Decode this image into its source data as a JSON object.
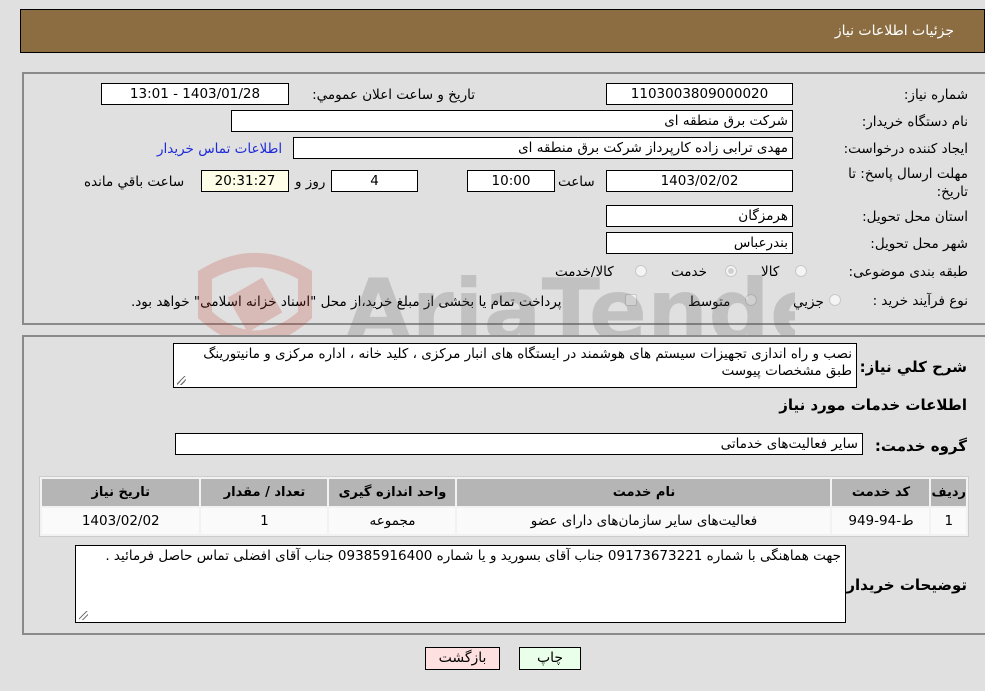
{
  "header": {
    "title": "جزئیات اطلاعات نیاز"
  },
  "form": {
    "need_number": {
      "label": "شماره نیاز:",
      "value": "1103003809000020"
    },
    "announce_datetime": {
      "label": "تاریخ و ساعت اعلان عمومي:",
      "value": "1403/01/28 - 13:01"
    },
    "buyer_org": {
      "label": "نام دستگاه خریدار:",
      "value": "شرکت برق منطقه ای"
    },
    "requester": {
      "label": "ایجاد کننده درخواست:",
      "value": "مهدی ترابی زاده کارپرداز شرکت برق منطقه ای"
    },
    "buyer_contact_link": "اطلاعات تماس خریدار",
    "deadline": {
      "label": "مهلت ارسال پاسخ: تا تاریخ:",
      "date": "1403/02/02",
      "time_label": "ساعت",
      "time": "10:00",
      "days": "4",
      "days_label": "روز و",
      "remaining": "20:31:27",
      "remaining_label": "ساعت باقي مانده"
    },
    "province": {
      "label": "استان محل تحویل:",
      "value": "هرمزگان"
    },
    "city": {
      "label": "شهر محل تحویل:",
      "value": "بندرعباس"
    },
    "category": {
      "label": "طبقه بندی موضوعی:",
      "options": [
        "کالا",
        "خدمت",
        "کالا/خدمت"
      ],
      "selected": "خدمت"
    },
    "purchase_type": {
      "label": "نوع فرآیند خرید :",
      "options": [
        "جزيي",
        "متوسط"
      ],
      "selected": "جزيي",
      "treasury_note": "پرداخت تمام یا بخشی از مبلغ خرید،از محل \"اسناد خزانه اسلامی\" خواهد بود.",
      "treasury_checked": false
    }
  },
  "description": {
    "label": "شرح كلي نياز:",
    "value": "نصب و راه اندازی تجهیزات سیستم های  هوشمند در ایستگاه های انبار مرکزی ، کلید خانه ، اداره مرکزی و مانیتورینگ طبق مشخصات پیوست"
  },
  "services_section": {
    "title": "اطلاعات خدمات مورد نیاز",
    "group_label": "گروه خدمت:",
    "group_value": "سایر فعالیت‌های خدماتی",
    "table": {
      "headers": [
        "ردیف",
        "کد خدمت",
        "نام خدمت",
        "واحد اندازه گیری",
        "تعداد / مقدار",
        "تاریخ نیاز"
      ],
      "rows": [
        [
          "1",
          "ط-94-949",
          "فعالیت‌های سایر سازمان‌های دارای عضو",
          "مجموعه",
          "1",
          "1403/02/02"
        ]
      ]
    }
  },
  "buyer_notes": {
    "label": "توضیحات خریدار:",
    "value": "جهت هماهنگی با شماره 09173673221 جناب آقای بسورید و یا شماره 09385916400 جناب آقای افضلی تماس حاصل فرمائید ."
  },
  "buttons": {
    "print": "چاپ",
    "back": "بازگشت"
  },
  "colors": {
    "header_bg": "#8c6d42",
    "print_bg": "#eaffea",
    "back_bg": "#ffe0e0",
    "link": "#1e2ad8"
  },
  "watermark": {
    "text": "AriaTender.net"
  }
}
